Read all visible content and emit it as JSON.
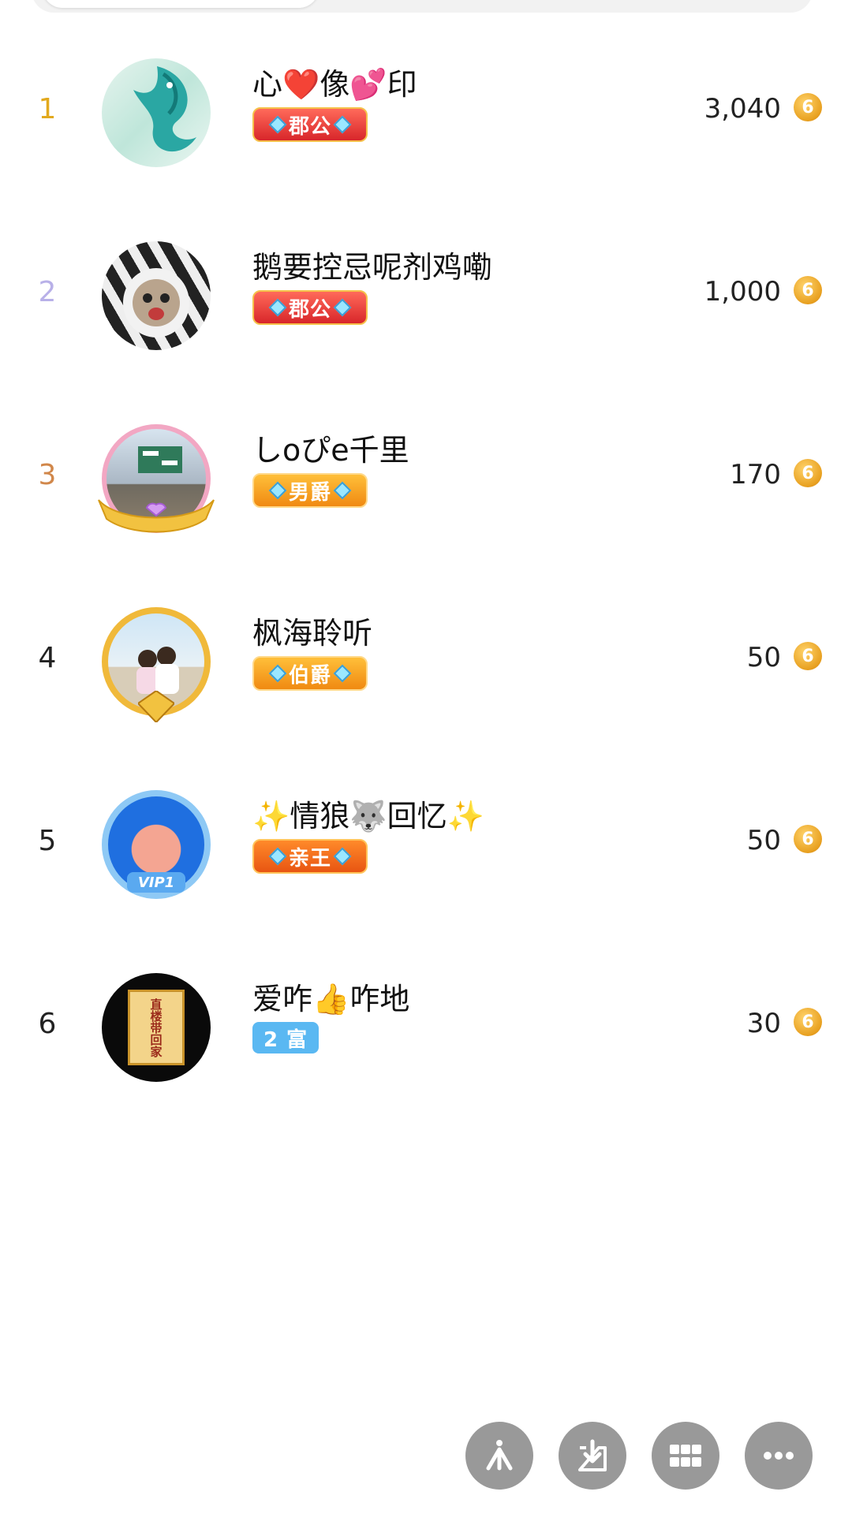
{
  "colors": {
    "rank1": "#e2a91d",
    "rank2": "#b8b0e8",
    "rank3": "#d1874a",
    "rank_other": "#222222",
    "coin": "#e8a020",
    "fab_bg": "#999999"
  },
  "ranking": [
    {
      "rank": "1",
      "name": "心❤️像💕印",
      "badge": "郡公",
      "badge_type": "red",
      "score": "3,040"
    },
    {
      "rank": "2",
      "name": "鹅要控忌呢剂鸡嘞",
      "badge": "郡公",
      "badge_type": "red",
      "score": "1,000"
    },
    {
      "rank": "3",
      "name": "しoぴe千里",
      "badge": "男爵",
      "badge_type": "orange",
      "score": "170"
    },
    {
      "rank": "4",
      "name": "枫海聆听",
      "badge": "伯爵",
      "badge_type": "orange",
      "score": "50"
    },
    {
      "rank": "5",
      "name": "✨情狼🐺回忆✨",
      "badge": "亲王",
      "badge_type": "crown-orange",
      "score": "50"
    },
    {
      "rank": "6",
      "name": "爱咋👍咋地",
      "badge": "2 富",
      "badge_type": "blue",
      "score": "30"
    }
  ],
  "coin_symbol": "6",
  "avatar6_text": "直楼带回家",
  "fabs": [
    {
      "icon": "share-icon"
    },
    {
      "icon": "download-icon"
    },
    {
      "icon": "grid-icon"
    },
    {
      "icon": "more-icon"
    }
  ]
}
